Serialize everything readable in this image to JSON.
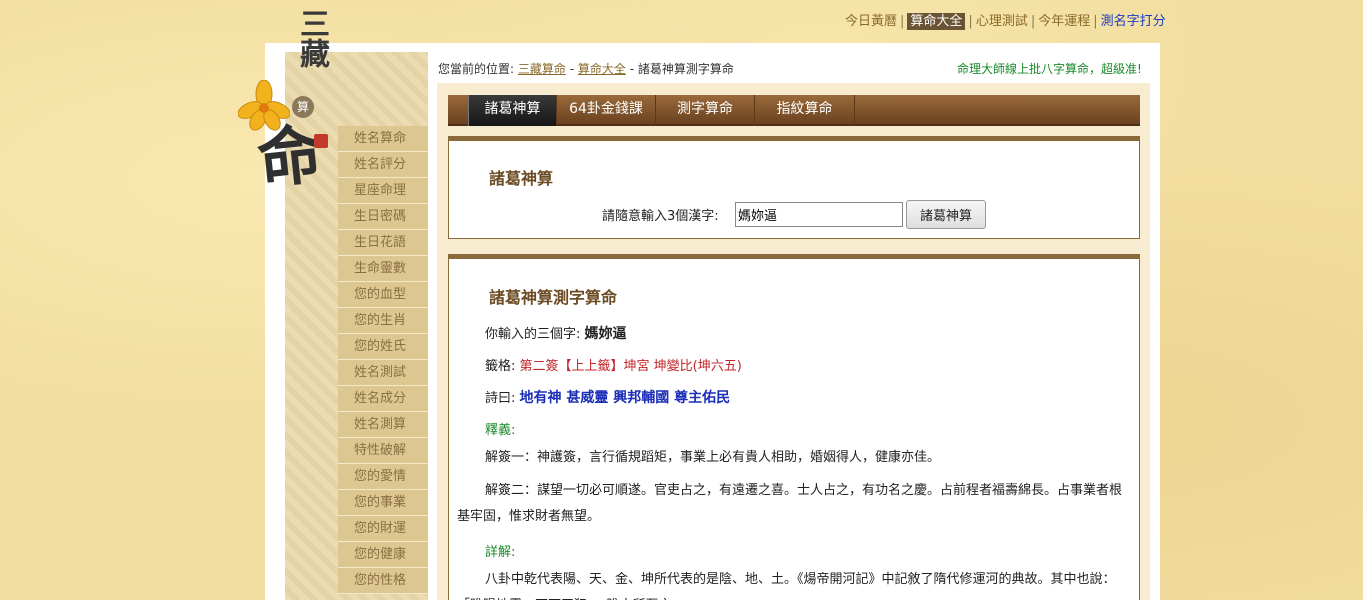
{
  "topnav": {
    "items": [
      "今日黃曆",
      "算命大全",
      "心理測試",
      "今年運程",
      "測名字打分"
    ],
    "active_index": 1
  },
  "logo": {
    "title": "三藏",
    "sub": "算",
    "main": "命"
  },
  "sidebar": {
    "items": [
      "姓名算命",
      "姓名評分",
      "星座命理",
      "生日密碼",
      "生日花語",
      "生命靈數",
      "您的血型",
      "您的生肖",
      "您的姓氏",
      "姓名測試",
      "姓名成分",
      "姓名測算",
      "特性破解",
      "您的愛情",
      "您的事業",
      "您的財運",
      "您的健康",
      "您的性格"
    ]
  },
  "breadcrumb": {
    "prefix": "您當前的位置:",
    "link1": "三藏算命",
    "link2": "算命大全",
    "sep": "-",
    "current": "諸葛神算測字算命"
  },
  "promo": "命理大師線上批八字算命，超級准!",
  "tabs": [
    "諸葛神算",
    "64卦金錢課",
    "測字算命",
    "指紋算命"
  ],
  "form": {
    "heading": "諸葛神算",
    "label": "請隨意輸入3個漢字:",
    "input_value": "媽妳逼",
    "button": "諸葛神算"
  },
  "result": {
    "heading": "諸葛神算測字算命",
    "input_label": "你輸入的三個字:",
    "input_value": "媽妳逼",
    "sign_label": "籤格:",
    "sign_value": "第二簽【上上籤】坤宮 坤變比(坤六五)",
    "poem_label": "詩曰:",
    "poem_value": "地有神 甚威靈 興邦輔國 尊主佑民",
    "explain_label": "釋義:",
    "explain1": "解簽一：神護簽，言行循規蹈矩，事業上必有貴人相助，婚姻得人，健康亦佳。",
    "explain2": "解簽二：謀望一切必可順遂。官吏占之，有遠遷之喜。士人占之，有功名之慶。占前程者福壽綿長。占事業者根基牢固，惟求財者無望。",
    "detail_label": "詳解:",
    "detail": "八卦中乾代表陽、天、金、坤所代表的是陰、地、土。《煬帝開河記》中記敘了隋代修運河的典故。其中",
    "detail_cut": "也說：「睢陽地靈，不可干犯。」睢水所至之，……"
  }
}
